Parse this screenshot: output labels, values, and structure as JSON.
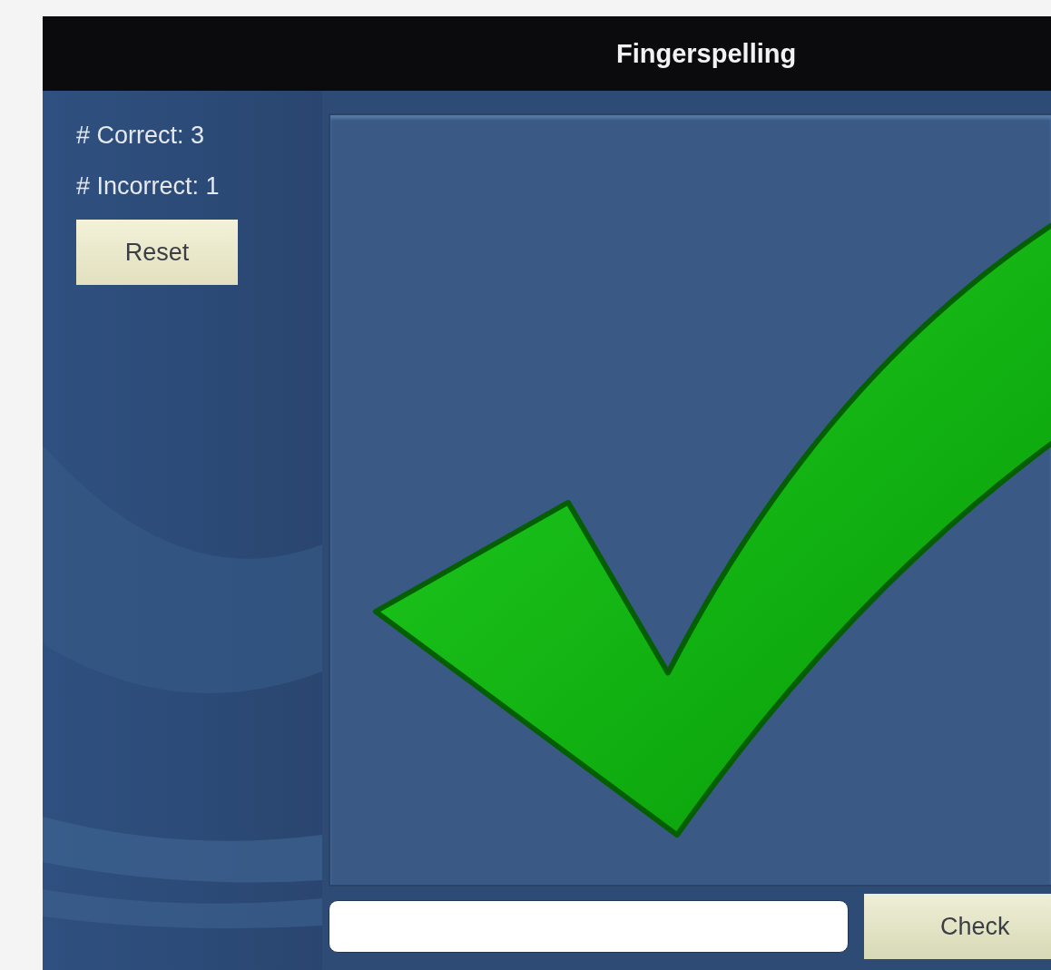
{
  "window": {
    "title": "Fingerspelling"
  },
  "score": [
    {
      "label": "# Correct:",
      "value": "3"
    },
    {
      "label": "# Incorrect:",
      "value": "1"
    }
  ],
  "reset_button": "Reset",
  "result": {
    "kind": "correct"
  },
  "check_button": "Check"
}
